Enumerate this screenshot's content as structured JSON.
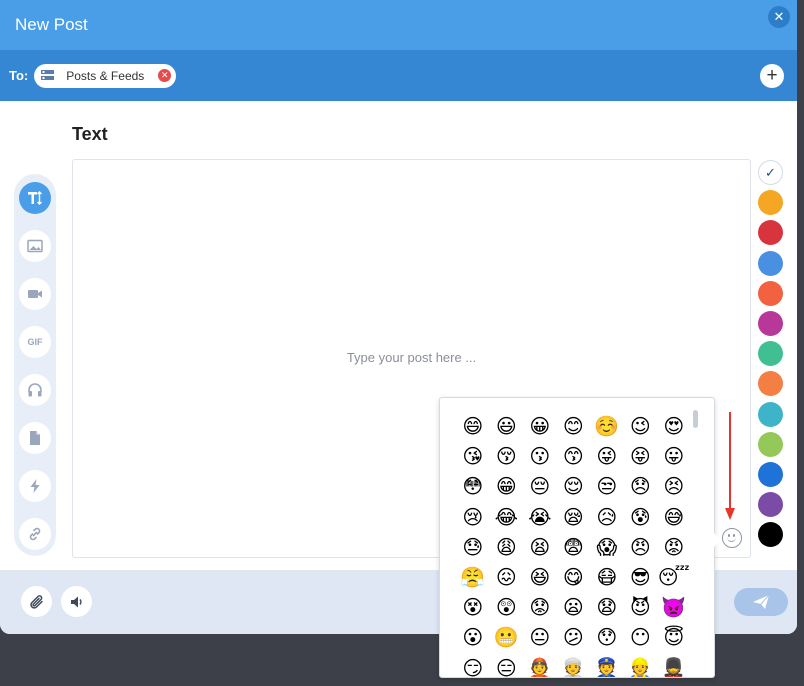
{
  "header": {
    "title": "New Post",
    "close_icon": "close-icon"
  },
  "to_bar": {
    "label": "To:",
    "chip": {
      "label": "Posts & Feeds",
      "icon": "feed-icon",
      "remove_icon": "remove-icon"
    },
    "add_icon": "plus-icon"
  },
  "editor": {
    "title": "Text",
    "placeholder": "Type your post here ..."
  },
  "post_types": [
    {
      "name": "text",
      "icon": "text-format-icon",
      "active": true
    },
    {
      "name": "image",
      "icon": "image-icon",
      "active": false
    },
    {
      "name": "video",
      "icon": "video-icon",
      "active": false
    },
    {
      "name": "gif",
      "icon": "gif-icon",
      "label": "GIF",
      "active": false
    },
    {
      "name": "audio",
      "icon": "headphones-icon",
      "active": false
    },
    {
      "name": "document",
      "icon": "document-icon",
      "active": false
    },
    {
      "name": "flash",
      "icon": "lightning-icon",
      "active": false
    },
    {
      "name": "link",
      "icon": "link-icon",
      "active": false
    }
  ],
  "colors": {
    "selected_mark": "✓",
    "swatches": [
      "#ffffff",
      "#f5a623",
      "#d8343e",
      "#4a90e2",
      "#f26241",
      "#b8389a",
      "#3fbf92",
      "#f47f42",
      "#3eb4c9",
      "#94c95a",
      "#1f72d8",
      "#7b4ca5",
      "#000000"
    ]
  },
  "footer": {
    "attach_icon": "paperclip-icon",
    "audio_icon": "speaker-icon",
    "send_icon": "send-icon"
  },
  "emoji_panel": {
    "trigger_icon": "smiley-icon",
    "emojis": [
      "😄",
      "😃",
      "😀",
      "😊",
      "☺️",
      "😉",
      "😍",
      "😘",
      "😚",
      "😗",
      "😙",
      "😜",
      "😝",
      "😛",
      "😳",
      "😁",
      "😔",
      "😌",
      "😒",
      "😞",
      "😣",
      "😢",
      "😂",
      "😭",
      "😪",
      "😥",
      "😰",
      "😅",
      "😓",
      "😩",
      "😫",
      "😨",
      "😱",
      "😠",
      "😡",
      "😤",
      "😖",
      "😆",
      "😋",
      "😷",
      "😎",
      "😴",
      "😵",
      "😲",
      "😟",
      "😦",
      "😧",
      "😈",
      "👿",
      "😮",
      "😬",
      "😐",
      "😕",
      "😯",
      "😶",
      "😇",
      "😏",
      "😑",
      "👲",
      "👳",
      "👮",
      "👷",
      "💂"
    ]
  },
  "annotation": {
    "color": "#e8352b"
  }
}
